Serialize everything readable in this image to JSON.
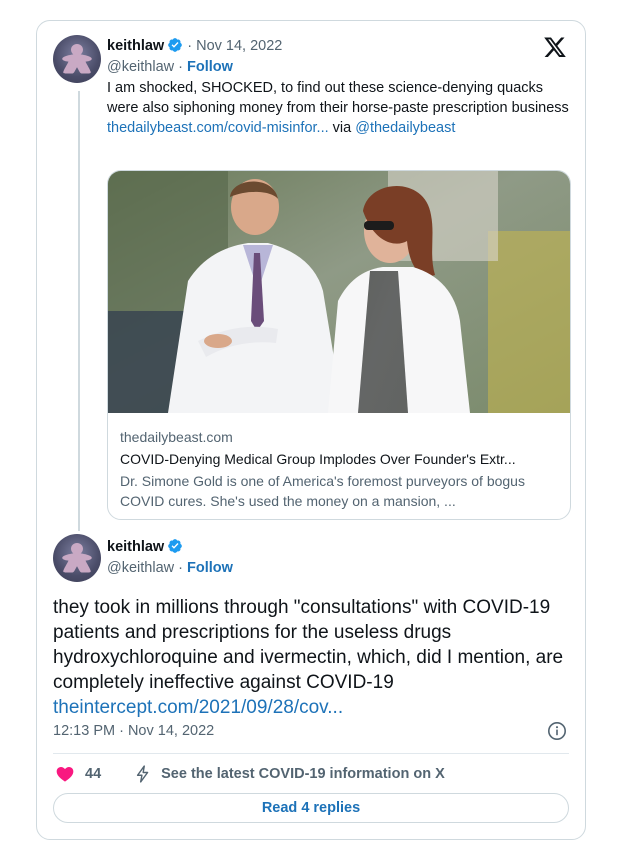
{
  "tweet1": {
    "username": "keithlaw",
    "handle": "@keithlaw",
    "date_sep": "· Nov 14, 2022",
    "handle_sep": "·",
    "follow": "Follow",
    "text": "I am shocked, SHOCKED, to find out these science-denying quacks were also siphoning money from their horse-paste prescription business",
    "link_text": "thedailybeast.com/covid-misinfor...",
    "via": "via",
    "via_handle": "@thedailybeast"
  },
  "link_card": {
    "domain": "thedailybeast.com",
    "title": "COVID-Denying Medical Group Implodes Over Founder's Extr...",
    "description": "Dr. Simone Gold is one of America's foremost purveyors of bogus COVID cures. She's used the money on a mansion, ...",
    "image_icon": "news-photo-doctors"
  },
  "tweet2": {
    "username": "keithlaw",
    "handle": "@keithlaw",
    "handle_sep": "·",
    "follow": "Follow",
    "text": "they took in millions through \"consultations\" with COVID-19 patients and prescriptions for the useless drugs hydroxychloroquine and ivermectin, which, did I mention, are completely ineffective against COVID-19",
    "link_text": "theintercept.com/2021/09/28/cov...",
    "timestamp": "12:13 PM · Nov 14, 2022"
  },
  "actions": {
    "like_count": "44",
    "latest_info": "See the latest COVID-19 information on X",
    "replies_button": "Read 4 replies"
  },
  "icons": {
    "brand": "x-logo-icon",
    "verified": "verified-badge-icon",
    "info": "info-icon",
    "like": "heart-icon",
    "latest": "lightning-icon"
  },
  "colors": {
    "link": "#1d72b8",
    "verified": "#1d9bf0",
    "heart": "#f91880",
    "border": "#cfd9de",
    "muted": "#536471"
  }
}
